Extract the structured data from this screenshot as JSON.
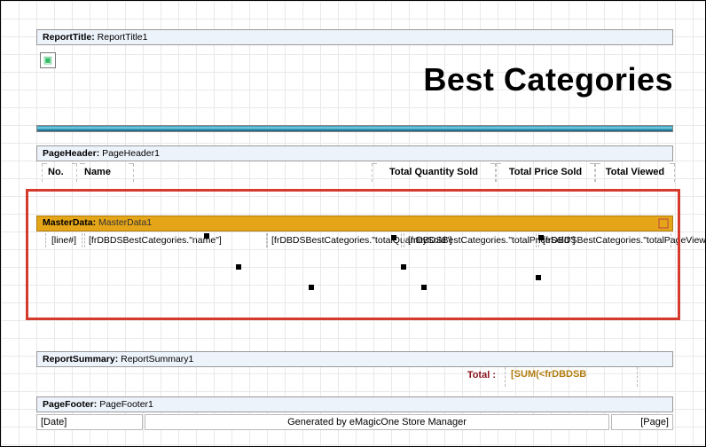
{
  "reportTitle": {
    "label": "ReportTitle:",
    "name": "ReportTitle1",
    "text": "Best Categories"
  },
  "pageHeader": {
    "label": "PageHeader:",
    "name": "PageHeader1",
    "cols": {
      "no": "No.",
      "name": "Name",
      "qty": "Total Quantity Sold",
      "price": "Total Price Sold",
      "viewed": "Total Viewed"
    }
  },
  "masterData": {
    "label": "MasterData:",
    "name": "MasterData1",
    "fields": {
      "line": "[line#]",
      "name": "[frDBDSBestCategories.\"name\"]",
      "qty": "[frDBDSBestCategories.\"totalQuantitySold\"]",
      "price": "[frDBDSBestCategories.\"totalPriceSold\"]",
      "viewed": "[frDBDSBestCategories.\"totalPageViewed\"]"
    }
  },
  "reportSummary": {
    "label": "ReportSummary:",
    "name": "ReportSummary1",
    "total_label": "Total :",
    "total_expr": "[SUM(<frDBDSB"
  },
  "pageFooter": {
    "label": "PageFooter:",
    "name": "PageFooter1",
    "date": "[Date]",
    "generated": "Generated by eMagicOne Store Manager",
    "page": "[Page]"
  },
  "icons": {
    "image_placeholder": "image-icon",
    "dropdown": "chevron-down-icon"
  }
}
